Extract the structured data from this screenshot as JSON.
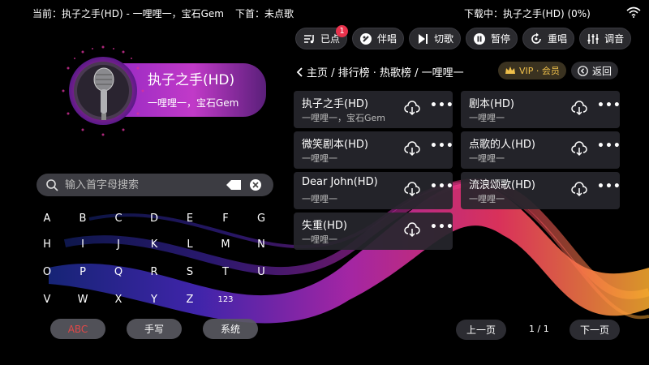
{
  "topbar": {
    "now_playing": "当前：执子之手(HD) - 一哩哩一，宝石Gem",
    "next": "下首：未点歌",
    "download": "下载中：执子之手(HD) (0%)"
  },
  "toolbar": [
    {
      "label": "已点",
      "icon": "queue-icon",
      "badge": "1"
    },
    {
      "label": "伴唱",
      "icon": "accompany-icon"
    },
    {
      "label": "切歌",
      "icon": "skip-icon"
    },
    {
      "label": "暂停",
      "icon": "pause-icon"
    },
    {
      "label": "重唱",
      "icon": "replay-icon"
    },
    {
      "label": "调音",
      "icon": "mixer-icon"
    }
  ],
  "breadcrumb": {
    "text": "主页 / 排行榜 · 热歌榜 / 一哩哩一",
    "vip_label": "VIP · 会员",
    "back_label": "返回"
  },
  "songs": [
    {
      "title": "执子之手(HD)",
      "artist": "一哩哩一，宝石Gem"
    },
    {
      "title": "剧本(HD)",
      "artist": "一哩哩一"
    },
    {
      "title": "微笑剧本(HD)",
      "artist": "一哩哩一"
    },
    {
      "title": "点歌的人(HD)",
      "artist": "一哩哩一"
    },
    {
      "title": "Dear John(HD)",
      "artist": "一哩哩一"
    },
    {
      "title": "流浪颂歌(HD)",
      "artist": "一哩哩一"
    },
    {
      "title": "失重(HD)",
      "artist": "一哩哩一"
    }
  ],
  "pager": {
    "prev": "上一页",
    "page": "1 / 1",
    "next": "下一页"
  },
  "now": {
    "title": "执子之手(HD)",
    "artist": "一哩哩一，宝石Gem"
  },
  "search": {
    "placeholder": "输入首字母搜索"
  },
  "keys": [
    [
      "A",
      "B",
      "C",
      "D",
      "E",
      "F",
      "G"
    ],
    [
      "H",
      "I",
      "J",
      "K",
      "L",
      "M",
      "N"
    ],
    [
      "O",
      "P",
      "Q",
      "R",
      "S",
      "T",
      "U"
    ],
    [
      "V",
      "W",
      "X",
      "Y",
      "Z",
      "123"
    ]
  ],
  "modes": [
    {
      "label": "ABC",
      "active": true
    },
    {
      "label": "手写",
      "active": false
    },
    {
      "label": "系统",
      "active": false
    }
  ],
  "colors": {
    "accent": "#c13ac8",
    "badge": "#e8324c",
    "vip": "#f0c04a",
    "active_mode": "#e24848"
  }
}
